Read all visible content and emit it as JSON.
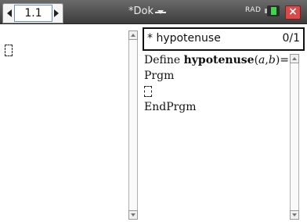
{
  "header": {
    "tab_label": "1.1",
    "doc_title": "*Dok",
    "mode": "RAD"
  },
  "editor": {
    "title_name": "* hypotenuse",
    "title_count": "0/1",
    "line1_define": "Define ",
    "line1_func": "hypotenuse",
    "line1_paren_open": "(",
    "line1_arg_a": "a",
    "line1_comma": ",",
    "line1_arg_b": "b",
    "line1_paren_close": ")",
    "line1_equals": "=",
    "line2": "Prgm",
    "line4": "EndPrgm"
  },
  "colors": {
    "battery": "#3ed64a",
    "close": "#d94a4a",
    "tab_border": "#6a8fb8"
  },
  "icons": [
    "left-arrow-icon",
    "right-arrow-icon",
    "chevron-down-icon",
    "battery-icon",
    "close-icon",
    "cursor-box-icon"
  ]
}
